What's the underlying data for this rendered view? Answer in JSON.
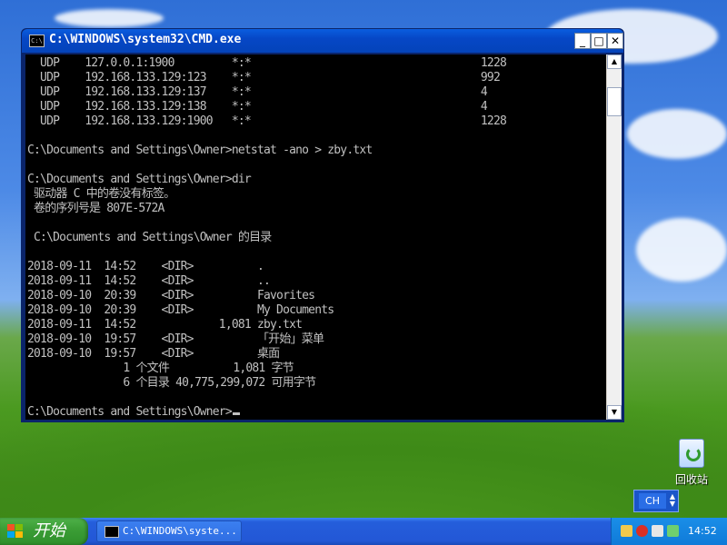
{
  "window": {
    "title": "C:\\WINDOWS\\system32\\CMD.exe",
    "minimize_glyph": "_",
    "maximize_glyph": "□",
    "close_glyph": "✕"
  },
  "console": {
    "lines": [
      "  UDP    127.0.0.1:1900         *:*                                    1228",
      "  UDP    192.168.133.129:123    *:*                                    992",
      "  UDP    192.168.133.129:137    *:*                                    4",
      "  UDP    192.168.133.129:138    *:*                                    4",
      "  UDP    192.168.133.129:1900   *:*                                    1228",
      "",
      "C:\\Documents and Settings\\Owner>netstat -ano > zby.txt",
      "",
      "C:\\Documents and Settings\\Owner>dir",
      " 驱动器 C 中的卷没有标签。",
      " 卷的序列号是 807E-572A",
      "",
      " C:\\Documents and Settings\\Owner 的目录",
      "",
      "2018-09-11  14:52    <DIR>          .",
      "2018-09-11  14:52    <DIR>          ..",
      "2018-09-10  20:39    <DIR>          Favorites",
      "2018-09-10  20:39    <DIR>          My Documents",
      "2018-09-11  14:52             1,081 zby.txt",
      "2018-09-10  19:57    <DIR>          「开始」菜单",
      "2018-09-10  19:57    <DIR>          桌面",
      "               1 个文件          1,081 字节",
      "               6 个目录 40,775,299,072 可用字节",
      "",
      "C:\\Documents and Settings\\Owner>"
    ]
  },
  "desktop": {
    "recycle_bin_label": "回收站"
  },
  "language_bar": {
    "label": "CH"
  },
  "taskbar": {
    "start_label": "开始",
    "task_label": "C:\\WINDOWS\\syste...",
    "clock": "14:52"
  },
  "icons": [
    "cmd-icon",
    "minimize-icon",
    "maximize-icon",
    "close-icon",
    "scroll-up-icon",
    "scroll-down-icon",
    "mouse-pointer-icon",
    "recycle-bin-icon",
    "windows-flag-icon",
    "tray-network-icon",
    "tray-security-icon",
    "tray-speaker-icon",
    "tray-update-icon"
  ],
  "colors": {
    "titlebar": "#0a5ddf",
    "console_bg": "#000000",
    "console_text": "#c0c0c0",
    "start_button": "#3c9e36",
    "taskbar": "#245edb"
  }
}
